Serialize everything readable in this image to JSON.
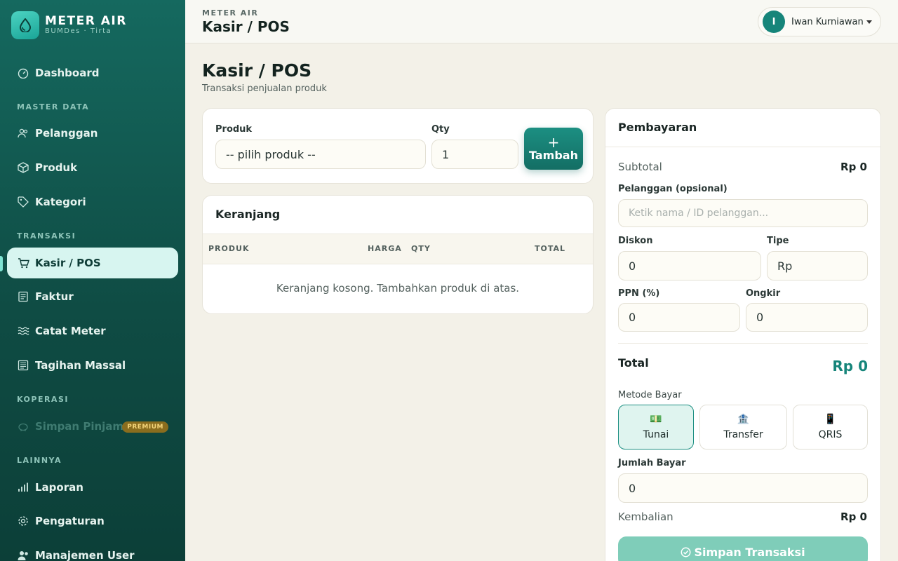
{
  "brand": {
    "title": "METER AIR",
    "subtitle": "BUMDes · Tirta",
    "icon": "water-drop-icon"
  },
  "sidebar": {
    "dashboard": "Dashboard",
    "sections": {
      "master": "MASTER DATA",
      "transaksi": "TRANSAKSI",
      "koperasi": "KOPERASI",
      "lainnya": "LAINNYA"
    },
    "items": {
      "pelanggan": "Pelanggan",
      "produk": "Produk",
      "kategori": "Kategori",
      "kasir": "Kasir / POS",
      "faktur": "Faktur",
      "catat_meter": "Catat Meter",
      "tagihan": "Tagihan Massal",
      "simpan_pinjam": "Simpan Pinjam",
      "laporan": "Laporan",
      "pengaturan": "Pengaturan",
      "manajemen_user": "Manajemen User"
    },
    "premium_badge": "PREMIUM"
  },
  "header": {
    "crumb": "METER AIR",
    "title": "Kasir / POS",
    "user_initial": "I",
    "user_name": "Iwan Kurniawan"
  },
  "page": {
    "title": "Kasir / POS",
    "subtitle": "Transaksi penjualan produk"
  },
  "product_form": {
    "product_label": "Produk",
    "product_value": "-- pilih produk --",
    "qty_label": "Qty",
    "qty_value": "1",
    "add_plus": "+",
    "add_label": "Tambah"
  },
  "cart": {
    "title": "Keranjang",
    "columns": [
      "PRODUK",
      "HARGA",
      "QTY",
      "TOTAL"
    ],
    "empty": "Keranjang kosong. Tambahkan produk di atas."
  },
  "payment": {
    "title": "Pembayaran",
    "subtotal_label": "Subtotal",
    "subtotal_value": "Rp 0",
    "customer_label": "Pelanggan (opsional)",
    "customer_placeholder": "Ketik nama / ID pelanggan...",
    "discount_label": "Diskon",
    "discount_value": "0",
    "type_label": "Tipe",
    "type_value": "Rp",
    "ppn_label": "PPN (%)",
    "ppn_value": "0",
    "ongkir_label": "Ongkir",
    "ongkir_value": "0",
    "total_label": "Total",
    "total_value": "Rp 0",
    "method_label": "Metode Bayar",
    "methods": [
      {
        "label": "Tunai",
        "icon": "💵"
      },
      {
        "label": "Transfer",
        "icon": "🏦"
      },
      {
        "label": "QRIS",
        "icon": "📱"
      }
    ],
    "amount_label": "Jumlah Bayar",
    "amount_value": "0",
    "change_label": "Kembalian",
    "change_value": "Rp 0",
    "save_label": "Simpan Transaksi"
  },
  "colors": {
    "accent": "#16857a",
    "sidebar": "#0f4c44",
    "total": "#16857a"
  }
}
